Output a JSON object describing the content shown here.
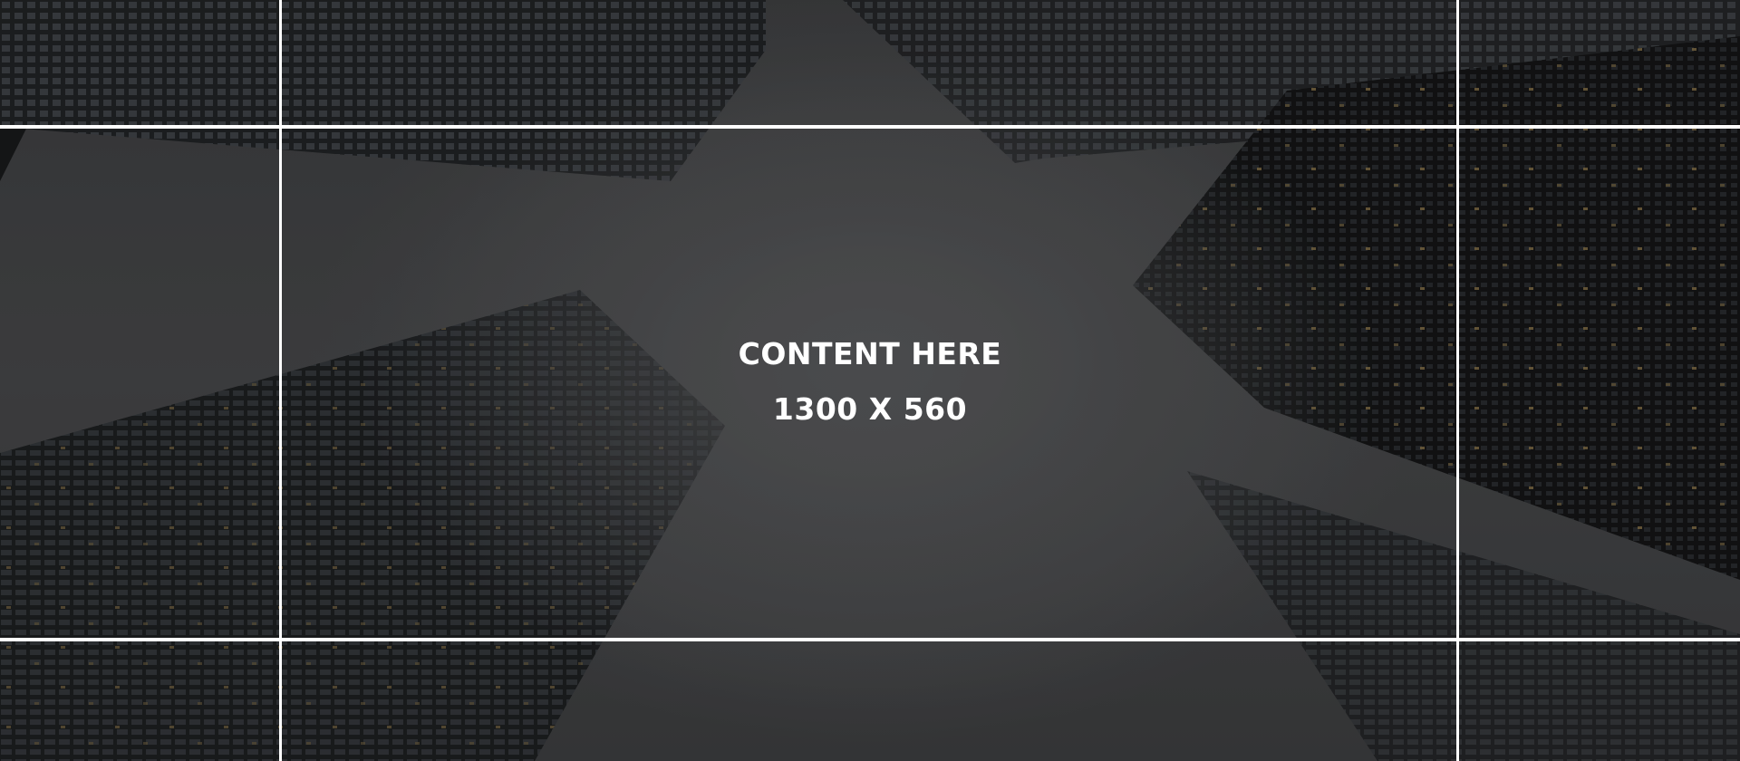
{
  "background": {
    "image": "skyscrapers-looking-up-icon",
    "tone_color": "#4a4b4d",
    "guide_color": "#ffffff"
  },
  "placeholder": {
    "title": "CONTENT HERE",
    "dimensions": "1300 X 560"
  }
}
